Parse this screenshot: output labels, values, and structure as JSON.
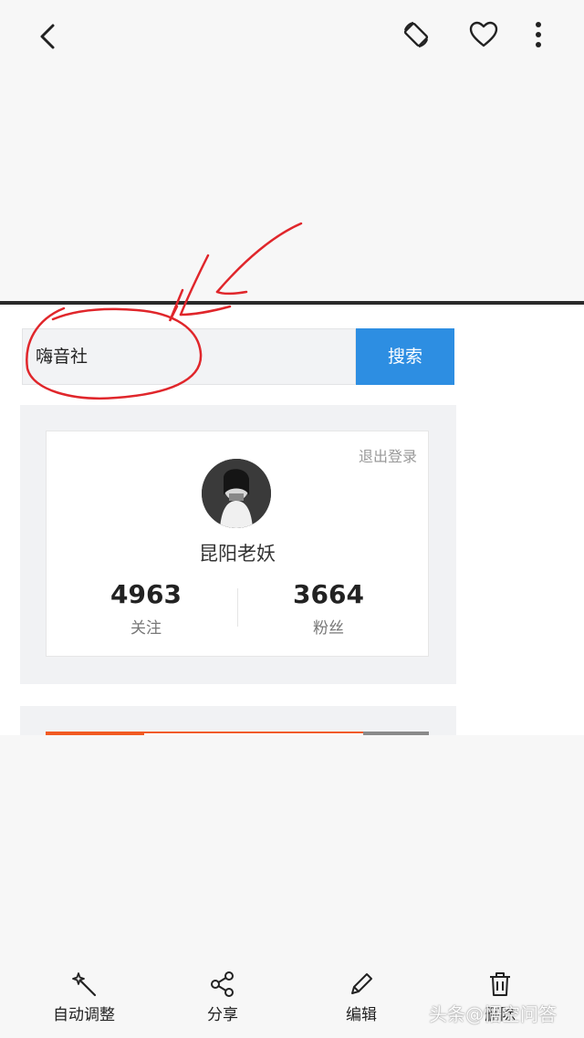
{
  "viewer": {
    "topbar": {
      "back_icon": "back-arrow-icon",
      "rotate_icon": "rotate-icon",
      "favorite_icon": "heart-icon",
      "more_icon": "more-vertical-icon"
    },
    "toolbar": [
      {
        "label": "自动调整",
        "icon": "magic-wand-icon"
      },
      {
        "label": "分享",
        "icon": "share-icon"
      },
      {
        "label": "编辑",
        "icon": "pencil-icon"
      },
      {
        "label": "删除",
        "icon": "trash-icon"
      }
    ],
    "watermark": "头条@悟空问答"
  },
  "screenshot": {
    "search": {
      "value": "嗨音社",
      "button_label": "搜索"
    },
    "profile": {
      "logout_label": "退出登录",
      "username": "昆阳老妖",
      "following_count": "4963",
      "following_label": "关注",
      "followers_count": "3664",
      "followers_label": "粉丝"
    }
  },
  "colors": {
    "search_button": "#2d8ee2",
    "annotation": "#e0262b",
    "accent_bar": "#f15a22"
  }
}
